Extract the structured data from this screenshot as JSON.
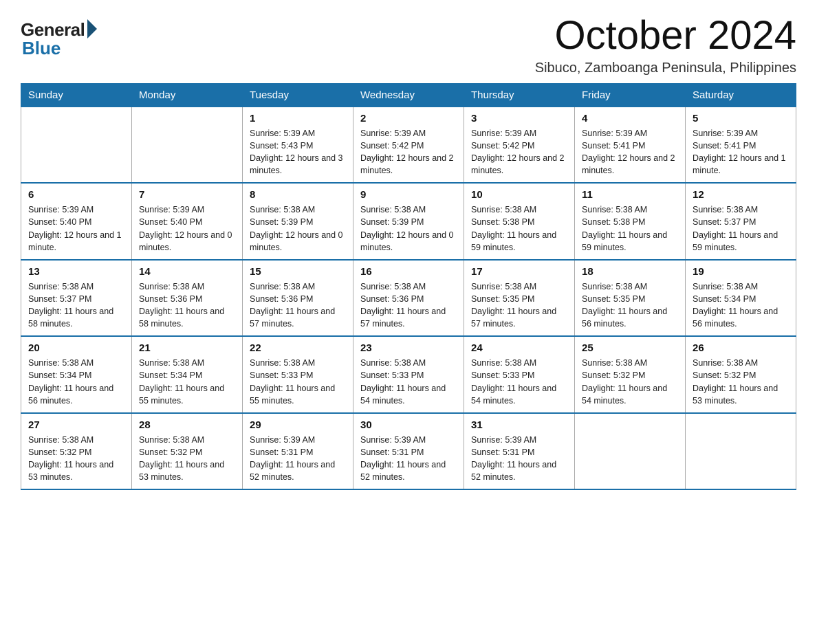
{
  "logo": {
    "general": "General",
    "blue": "Blue"
  },
  "title": "October 2024",
  "subtitle": "Sibuco, Zamboanga Peninsula, Philippines",
  "days_of_week": [
    "Sunday",
    "Monday",
    "Tuesday",
    "Wednesday",
    "Thursday",
    "Friday",
    "Saturday"
  ],
  "weeks": [
    [
      {
        "day": "",
        "info": ""
      },
      {
        "day": "",
        "info": ""
      },
      {
        "day": "1",
        "info": "Sunrise: 5:39 AM\nSunset: 5:43 PM\nDaylight: 12 hours and 3 minutes."
      },
      {
        "day": "2",
        "info": "Sunrise: 5:39 AM\nSunset: 5:42 PM\nDaylight: 12 hours and 2 minutes."
      },
      {
        "day": "3",
        "info": "Sunrise: 5:39 AM\nSunset: 5:42 PM\nDaylight: 12 hours and 2 minutes."
      },
      {
        "day": "4",
        "info": "Sunrise: 5:39 AM\nSunset: 5:41 PM\nDaylight: 12 hours and 2 minutes."
      },
      {
        "day": "5",
        "info": "Sunrise: 5:39 AM\nSunset: 5:41 PM\nDaylight: 12 hours and 1 minute."
      }
    ],
    [
      {
        "day": "6",
        "info": "Sunrise: 5:39 AM\nSunset: 5:40 PM\nDaylight: 12 hours and 1 minute."
      },
      {
        "day": "7",
        "info": "Sunrise: 5:39 AM\nSunset: 5:40 PM\nDaylight: 12 hours and 0 minutes."
      },
      {
        "day": "8",
        "info": "Sunrise: 5:38 AM\nSunset: 5:39 PM\nDaylight: 12 hours and 0 minutes."
      },
      {
        "day": "9",
        "info": "Sunrise: 5:38 AM\nSunset: 5:39 PM\nDaylight: 12 hours and 0 minutes."
      },
      {
        "day": "10",
        "info": "Sunrise: 5:38 AM\nSunset: 5:38 PM\nDaylight: 11 hours and 59 minutes."
      },
      {
        "day": "11",
        "info": "Sunrise: 5:38 AM\nSunset: 5:38 PM\nDaylight: 11 hours and 59 minutes."
      },
      {
        "day": "12",
        "info": "Sunrise: 5:38 AM\nSunset: 5:37 PM\nDaylight: 11 hours and 59 minutes."
      }
    ],
    [
      {
        "day": "13",
        "info": "Sunrise: 5:38 AM\nSunset: 5:37 PM\nDaylight: 11 hours and 58 minutes."
      },
      {
        "day": "14",
        "info": "Sunrise: 5:38 AM\nSunset: 5:36 PM\nDaylight: 11 hours and 58 minutes."
      },
      {
        "day": "15",
        "info": "Sunrise: 5:38 AM\nSunset: 5:36 PM\nDaylight: 11 hours and 57 minutes."
      },
      {
        "day": "16",
        "info": "Sunrise: 5:38 AM\nSunset: 5:36 PM\nDaylight: 11 hours and 57 minutes."
      },
      {
        "day": "17",
        "info": "Sunrise: 5:38 AM\nSunset: 5:35 PM\nDaylight: 11 hours and 57 minutes."
      },
      {
        "day": "18",
        "info": "Sunrise: 5:38 AM\nSunset: 5:35 PM\nDaylight: 11 hours and 56 minutes."
      },
      {
        "day": "19",
        "info": "Sunrise: 5:38 AM\nSunset: 5:34 PM\nDaylight: 11 hours and 56 minutes."
      }
    ],
    [
      {
        "day": "20",
        "info": "Sunrise: 5:38 AM\nSunset: 5:34 PM\nDaylight: 11 hours and 56 minutes."
      },
      {
        "day": "21",
        "info": "Sunrise: 5:38 AM\nSunset: 5:34 PM\nDaylight: 11 hours and 55 minutes."
      },
      {
        "day": "22",
        "info": "Sunrise: 5:38 AM\nSunset: 5:33 PM\nDaylight: 11 hours and 55 minutes."
      },
      {
        "day": "23",
        "info": "Sunrise: 5:38 AM\nSunset: 5:33 PM\nDaylight: 11 hours and 54 minutes."
      },
      {
        "day": "24",
        "info": "Sunrise: 5:38 AM\nSunset: 5:33 PM\nDaylight: 11 hours and 54 minutes."
      },
      {
        "day": "25",
        "info": "Sunrise: 5:38 AM\nSunset: 5:32 PM\nDaylight: 11 hours and 54 minutes."
      },
      {
        "day": "26",
        "info": "Sunrise: 5:38 AM\nSunset: 5:32 PM\nDaylight: 11 hours and 53 minutes."
      }
    ],
    [
      {
        "day": "27",
        "info": "Sunrise: 5:38 AM\nSunset: 5:32 PM\nDaylight: 11 hours and 53 minutes."
      },
      {
        "day": "28",
        "info": "Sunrise: 5:38 AM\nSunset: 5:32 PM\nDaylight: 11 hours and 53 minutes."
      },
      {
        "day": "29",
        "info": "Sunrise: 5:39 AM\nSunset: 5:31 PM\nDaylight: 11 hours and 52 minutes."
      },
      {
        "day": "30",
        "info": "Sunrise: 5:39 AM\nSunset: 5:31 PM\nDaylight: 11 hours and 52 minutes."
      },
      {
        "day": "31",
        "info": "Sunrise: 5:39 AM\nSunset: 5:31 PM\nDaylight: 11 hours and 52 minutes."
      },
      {
        "day": "",
        "info": ""
      },
      {
        "day": "",
        "info": ""
      }
    ]
  ]
}
